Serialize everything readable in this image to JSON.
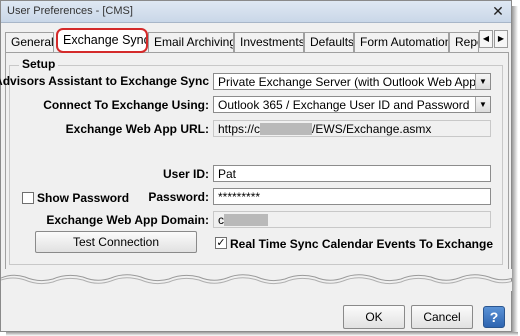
{
  "window": {
    "title": "User Preferences -  [CMS]",
    "close_glyph": "✕"
  },
  "tabs": [
    {
      "label": "General",
      "active": false
    },
    {
      "label": "Exchange Sync",
      "active": true
    },
    {
      "label": "Email Archiving",
      "active": false
    },
    {
      "label": "Investments",
      "active": false
    },
    {
      "label": "Defaults",
      "active": false
    },
    {
      "label": "Form Automation",
      "active": false
    },
    {
      "label": "Repo",
      "active": false
    }
  ],
  "tab_scroll": {
    "left_glyph": "◀",
    "right_glyph": "▶"
  },
  "setup": {
    "group_title": "Setup",
    "advisors_label": "Advisors Assistant to Exchange Sync",
    "advisors_value": "Private Exchange Server (with Outlook Web App)",
    "connect_label": "Connect To Exchange Using:",
    "connect_value": "Outlook 365 / Exchange User ID and Password",
    "url_label": "Exchange Web App URL:",
    "url_prefix": "https://c",
    "url_suffix": "/EWS/Exchange.asmx",
    "userid_label": "User ID:",
    "userid_value": "Pat",
    "show_password_label": "Show Password",
    "show_password_checked": false,
    "password_label": "Password:",
    "password_value": "*********",
    "domain_label": "Exchange Web App Domain:",
    "domain_prefix": "c",
    "test_button": "Test Connection",
    "realtime_label": "Real Time Sync Calendar Events To Exchange",
    "realtime_checked": true,
    "check_glyph": "✓",
    "dropdown_glyph": "▼"
  },
  "footer": {
    "ok": "OK",
    "cancel": "Cancel",
    "help": "?"
  },
  "colors": {
    "active_tab_border": "#d42a2a",
    "help_button": "#3a72c0"
  }
}
